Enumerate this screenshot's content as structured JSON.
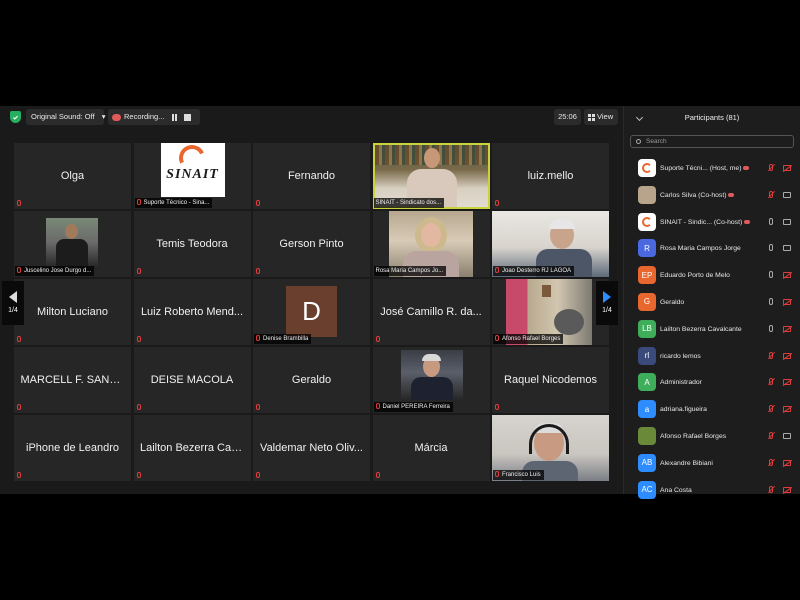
{
  "topbar": {
    "sound_label": "Original Sound: Off",
    "recording_label": "Recording...",
    "time": "25:06",
    "view_label": "View"
  },
  "tiles": [
    {
      "name": "Olga"
    },
    {
      "label": "Suporte Técnico - Sina..."
    },
    {
      "name": "Fernando"
    },
    {
      "label": "SINAIT - Sindicato dos..."
    },
    {
      "name": "luiz.mello"
    },
    {
      "label": "Juscelino Jose Durgo d..."
    },
    {
      "name": "Temis Teodora"
    },
    {
      "name": "Gerson Pinto"
    },
    {
      "label": "Rosa Maria Campos Jo..."
    },
    {
      "label": "Joao Desterro RJ LAGOA"
    },
    {
      "name": "Milton Luciano"
    },
    {
      "name": "Luiz Roberto Mend..."
    },
    {
      "label": "Denise Brambilla",
      "letter": "D"
    },
    {
      "name": "José Camillo R. da..."
    },
    {
      "label": "Afonso Rafael Borges"
    },
    {
      "name": "MARCELL F. SANTA..."
    },
    {
      "name": "DEISE MACOLA"
    },
    {
      "name": "Geraldo"
    },
    {
      "label": "Daniel PEREIRA Ferreira"
    },
    {
      "name": "Raquel Nicodemos"
    },
    {
      "name": "iPhone de Leandro"
    },
    {
      "name": "Lailton Bezerra Cav..."
    },
    {
      "name": "Valdemar Neto Oliv..."
    },
    {
      "name": "Márcia"
    },
    {
      "label": "Francisco Luis"
    }
  ],
  "logo_text": "SINAIT",
  "pager": {
    "left": "1/4",
    "right": "1/4"
  },
  "panel": {
    "title": "Participants (81)",
    "search_placeholder": "Search",
    "participants": [
      {
        "name": "Suporte Técni...",
        "role": "(Host, me)",
        "avatar": "",
        "color": "#ffffff",
        "mic": "on-red",
        "cam": "off"
      },
      {
        "name": "Carlos Silva",
        "role": "(Co-host)",
        "avatar": "",
        "color": "#b7a48a",
        "mic": "off",
        "cam": "on"
      },
      {
        "name": "SINAIT - Sindic...",
        "role": "(Co-host)",
        "avatar": "",
        "color": "#ffffff",
        "mic": "on",
        "cam": "on"
      },
      {
        "name": "Rosa Maria Campos Jorge",
        "role": "",
        "avatar": "R",
        "color": "#4a68e0",
        "mic": "on",
        "cam": "on"
      },
      {
        "name": "Eduardo Porto de Melo",
        "role": "",
        "avatar": "EP",
        "color": "#e8672f",
        "mic": "on",
        "cam": "off"
      },
      {
        "name": "Geraldo",
        "role": "",
        "avatar": "G",
        "color": "#e8672f",
        "mic": "on",
        "cam": "off"
      },
      {
        "name": "Lailton Bezerra Cavalcante",
        "role": "",
        "avatar": "LB",
        "color": "#3fae5a",
        "mic": "on",
        "cam": "off"
      },
      {
        "name": "ricardo lemos",
        "role": "",
        "avatar": "rl",
        "color": "#3a4a7a",
        "mic": "off",
        "cam": "off"
      },
      {
        "name": "Administrador",
        "role": "",
        "avatar": "A",
        "color": "#3fae5a",
        "mic": "off",
        "cam": "off"
      },
      {
        "name": "adriana.figueira",
        "role": "",
        "avatar": "a",
        "color": "#2d8cff",
        "mic": "off",
        "cam": "off"
      },
      {
        "name": "Afonso Rafael Borges",
        "role": "",
        "avatar": "",
        "color": "#6a8a3a",
        "mic": "off",
        "cam": "on"
      },
      {
        "name": "Alexandre Bibiani",
        "role": "",
        "avatar": "AB",
        "color": "#2d8cff",
        "mic": "off",
        "cam": "off"
      },
      {
        "name": "Ana Costa",
        "role": "",
        "avatar": "AC",
        "color": "#2d8cff",
        "mic": "off",
        "cam": "off"
      }
    ]
  }
}
